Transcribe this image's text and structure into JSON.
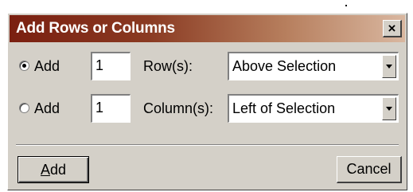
{
  "dialog": {
    "title": "Add Rows or Columns",
    "close_glyph": "×"
  },
  "rows_option": {
    "selected": true,
    "add_label": "Add",
    "count": "1",
    "unit_label": "Row(s):",
    "position_value": "Above Selection"
  },
  "columns_option": {
    "selected": false,
    "add_label": "Add",
    "count": "1",
    "unit_label": "Column(s):",
    "position_value": "Left of Selection"
  },
  "buttons": {
    "add_mnemonic": "A",
    "add_rest": "dd",
    "cancel_label": "Cancel"
  }
}
